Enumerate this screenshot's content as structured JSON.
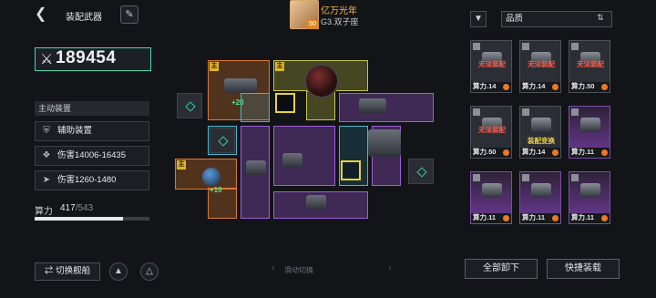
{
  "header": {
    "back_icon": "back-arrow-icon",
    "title": "装配武器",
    "edit_icon": "pen-icon",
    "player_name": "亿万光年",
    "player_level": "50",
    "player_sub": "G3.双子座"
  },
  "power": {
    "icon": "crossed-swords-icon",
    "value": "189454"
  },
  "active_gear": {
    "section_label": "主动装置",
    "items": [
      {
        "icon": "shield-icon",
        "label": "辅助装置"
      },
      {
        "icon": "multi-missile-icon",
        "label": "伤害14006-16435"
      },
      {
        "icon": "single-missile-icon",
        "label": "伤害1260-1480"
      }
    ]
  },
  "compute": {
    "label": "算力",
    "used": "417",
    "total": "/543",
    "fraction": 0.768
  },
  "grid": {
    "tag_main": "主",
    "bonus_a": "+20",
    "bonus_b": "+10"
  },
  "bottom": {
    "switch_ship": "切换舰船",
    "slide_hint": "滑动切换",
    "slide_left": "‹",
    "slide_right": "›"
  },
  "right_panel": {
    "filter_icon": "filter-icon",
    "sort_label": "品质",
    "sort_icon": "sort-icon",
    "cards": [
      {
        "status": "无法装配",
        "cost": "算力.14",
        "quality": "gray"
      },
      {
        "status": "无法装配",
        "cost": "算力.14",
        "quality": "gray"
      },
      {
        "status": "无法装配",
        "cost": "算力.50",
        "quality": "gray"
      },
      {
        "status": "无法装配",
        "cost": "算力.50",
        "quality": "gray"
      },
      {
        "status": "装配变换",
        "cost": "算力.14",
        "quality": "gray"
      },
      {
        "status": "",
        "cost": "算力.11",
        "quality": "purple"
      },
      {
        "status": "",
        "cost": "算力.11",
        "quality": "purple"
      },
      {
        "status": "",
        "cost": "算力.11",
        "quality": "purple"
      },
      {
        "status": "",
        "cost": "算力.11",
        "quality": "purple"
      }
    ],
    "unload_all": "全部卸下",
    "quick_equip": "快捷装载"
  },
  "colors": {
    "accent_cyan": "#47d6b2",
    "orange_slot": "#d87b33",
    "yellow_slot": "#c6c64a",
    "purple_slot": "#9d5fd6",
    "warn_red": "#ff5a4a"
  }
}
